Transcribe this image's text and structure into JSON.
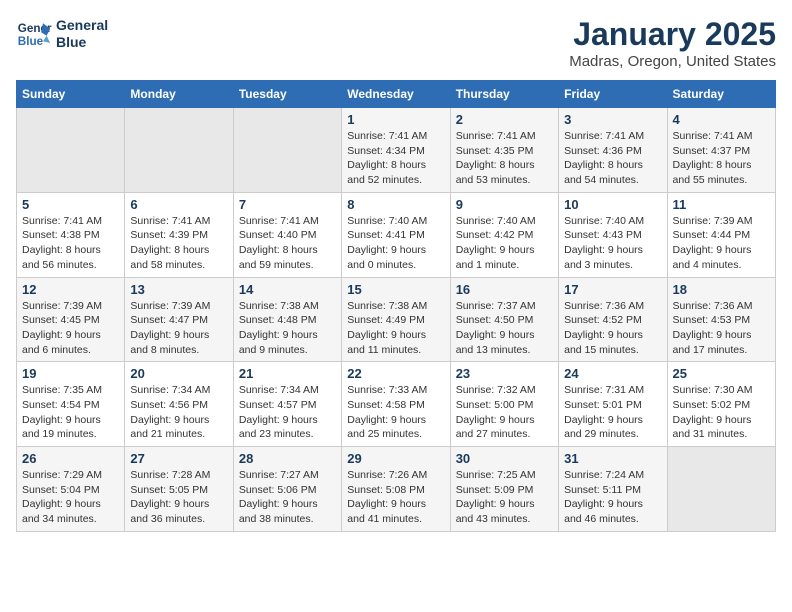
{
  "logo": {
    "line1": "General",
    "line2": "Blue"
  },
  "title": "January 2025",
  "subtitle": "Madras, Oregon, United States",
  "days_of_week": [
    "Sunday",
    "Monday",
    "Tuesday",
    "Wednesday",
    "Thursday",
    "Friday",
    "Saturday"
  ],
  "weeks": [
    [
      {
        "day": "",
        "empty": true
      },
      {
        "day": "",
        "empty": true
      },
      {
        "day": "",
        "empty": true
      },
      {
        "day": "1",
        "info": "Sunrise: 7:41 AM\nSunset: 4:34 PM\nDaylight: 8 hours and 52 minutes."
      },
      {
        "day": "2",
        "info": "Sunrise: 7:41 AM\nSunset: 4:35 PM\nDaylight: 8 hours and 53 minutes."
      },
      {
        "day": "3",
        "info": "Sunrise: 7:41 AM\nSunset: 4:36 PM\nDaylight: 8 hours and 54 minutes."
      },
      {
        "day": "4",
        "info": "Sunrise: 7:41 AM\nSunset: 4:37 PM\nDaylight: 8 hours and 55 minutes."
      }
    ],
    [
      {
        "day": "5",
        "info": "Sunrise: 7:41 AM\nSunset: 4:38 PM\nDaylight: 8 hours and 56 minutes."
      },
      {
        "day": "6",
        "info": "Sunrise: 7:41 AM\nSunset: 4:39 PM\nDaylight: 8 hours and 58 minutes."
      },
      {
        "day": "7",
        "info": "Sunrise: 7:41 AM\nSunset: 4:40 PM\nDaylight: 8 hours and 59 minutes."
      },
      {
        "day": "8",
        "info": "Sunrise: 7:40 AM\nSunset: 4:41 PM\nDaylight: 9 hours and 0 minutes."
      },
      {
        "day": "9",
        "info": "Sunrise: 7:40 AM\nSunset: 4:42 PM\nDaylight: 9 hours and 1 minute."
      },
      {
        "day": "10",
        "info": "Sunrise: 7:40 AM\nSunset: 4:43 PM\nDaylight: 9 hours and 3 minutes."
      },
      {
        "day": "11",
        "info": "Sunrise: 7:39 AM\nSunset: 4:44 PM\nDaylight: 9 hours and 4 minutes."
      }
    ],
    [
      {
        "day": "12",
        "info": "Sunrise: 7:39 AM\nSunset: 4:45 PM\nDaylight: 9 hours and 6 minutes."
      },
      {
        "day": "13",
        "info": "Sunrise: 7:39 AM\nSunset: 4:47 PM\nDaylight: 9 hours and 8 minutes."
      },
      {
        "day": "14",
        "info": "Sunrise: 7:38 AM\nSunset: 4:48 PM\nDaylight: 9 hours and 9 minutes."
      },
      {
        "day": "15",
        "info": "Sunrise: 7:38 AM\nSunset: 4:49 PM\nDaylight: 9 hours and 11 minutes."
      },
      {
        "day": "16",
        "info": "Sunrise: 7:37 AM\nSunset: 4:50 PM\nDaylight: 9 hours and 13 minutes."
      },
      {
        "day": "17",
        "info": "Sunrise: 7:36 AM\nSunset: 4:52 PM\nDaylight: 9 hours and 15 minutes."
      },
      {
        "day": "18",
        "info": "Sunrise: 7:36 AM\nSunset: 4:53 PM\nDaylight: 9 hours and 17 minutes."
      }
    ],
    [
      {
        "day": "19",
        "info": "Sunrise: 7:35 AM\nSunset: 4:54 PM\nDaylight: 9 hours and 19 minutes."
      },
      {
        "day": "20",
        "info": "Sunrise: 7:34 AM\nSunset: 4:56 PM\nDaylight: 9 hours and 21 minutes."
      },
      {
        "day": "21",
        "info": "Sunrise: 7:34 AM\nSunset: 4:57 PM\nDaylight: 9 hours and 23 minutes."
      },
      {
        "day": "22",
        "info": "Sunrise: 7:33 AM\nSunset: 4:58 PM\nDaylight: 9 hours and 25 minutes."
      },
      {
        "day": "23",
        "info": "Sunrise: 7:32 AM\nSunset: 5:00 PM\nDaylight: 9 hours and 27 minutes."
      },
      {
        "day": "24",
        "info": "Sunrise: 7:31 AM\nSunset: 5:01 PM\nDaylight: 9 hours and 29 minutes."
      },
      {
        "day": "25",
        "info": "Sunrise: 7:30 AM\nSunset: 5:02 PM\nDaylight: 9 hours and 31 minutes."
      }
    ],
    [
      {
        "day": "26",
        "info": "Sunrise: 7:29 AM\nSunset: 5:04 PM\nDaylight: 9 hours and 34 minutes."
      },
      {
        "day": "27",
        "info": "Sunrise: 7:28 AM\nSunset: 5:05 PM\nDaylight: 9 hours and 36 minutes."
      },
      {
        "day": "28",
        "info": "Sunrise: 7:27 AM\nSunset: 5:06 PM\nDaylight: 9 hours and 38 minutes."
      },
      {
        "day": "29",
        "info": "Sunrise: 7:26 AM\nSunset: 5:08 PM\nDaylight: 9 hours and 41 minutes."
      },
      {
        "day": "30",
        "info": "Sunrise: 7:25 AM\nSunset: 5:09 PM\nDaylight: 9 hours and 43 minutes."
      },
      {
        "day": "31",
        "info": "Sunrise: 7:24 AM\nSunset: 5:11 PM\nDaylight: 9 hours and 46 minutes."
      },
      {
        "day": "",
        "empty": true
      }
    ]
  ]
}
